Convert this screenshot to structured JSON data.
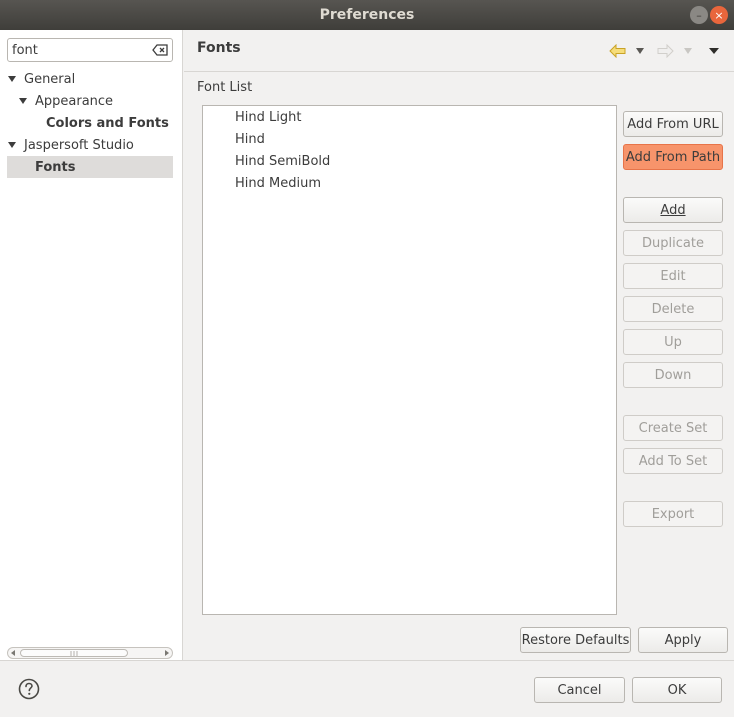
{
  "window": {
    "title": "Preferences",
    "minimize_glyph": "–",
    "close_glyph": "×"
  },
  "filter": {
    "value": "font",
    "clear_icon": "clear-filter-icon"
  },
  "tree": {
    "items": [
      {
        "label": "General",
        "expanded": true
      },
      {
        "label": "Appearance",
        "expanded": true
      },
      {
        "label": "Colors and Fonts"
      },
      {
        "label": "Jaspersoft Studio",
        "expanded": true
      },
      {
        "label": "Fonts",
        "selected": true
      }
    ]
  },
  "page": {
    "title": "Fonts",
    "section_label": "Font List",
    "nav_icons": [
      "back-arrow-icon",
      "back-dropdown-icon",
      "forward-arrow-icon",
      "forward-dropdown-icon",
      "view-menu-icon"
    ]
  },
  "font_list": {
    "items": [
      "Hind Light",
      "Hind",
      "Hind SemiBold",
      "Hind Medium"
    ]
  },
  "buttons": {
    "add_from_url": "Add From URL",
    "add_from_path": "Add From Path",
    "add": "Add",
    "duplicate": "Duplicate",
    "edit": "Edit",
    "delete": "Delete",
    "up": "Up",
    "down": "Down",
    "create_set": "Create Set",
    "add_to_set": "Add To Set",
    "export": "Export",
    "restore_defaults": "Restore Defaults",
    "apply": "Apply",
    "cancel": "Cancel",
    "ok": "OK"
  },
  "colors": {
    "accent": "#f7946b",
    "titlebar": "#4b4a46",
    "selection": "#dedcda"
  }
}
